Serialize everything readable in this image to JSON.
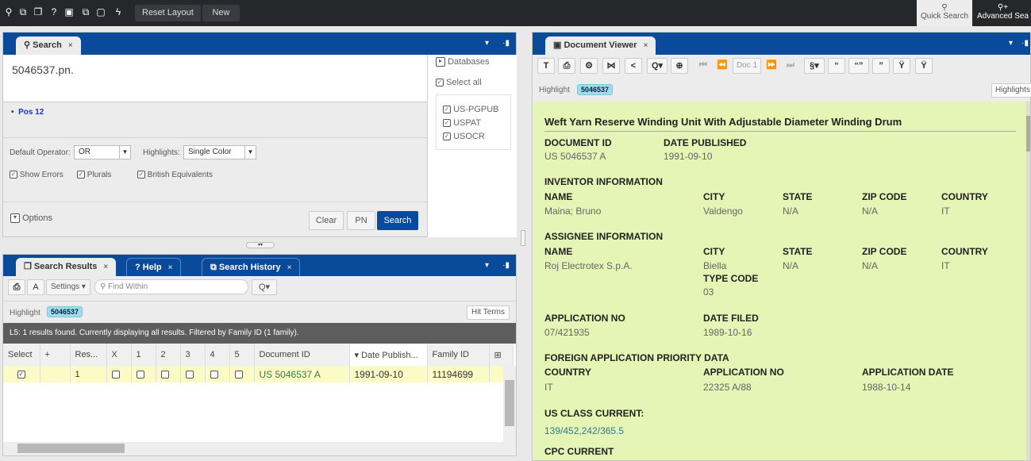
{
  "topbar": {
    "icons": [
      "search-icon",
      "search-copy-icon",
      "documents-icon",
      "help-icon",
      "save-icon",
      "export-icon",
      "blank-page-icon",
      "lightning-icon"
    ],
    "reset_layout": "Reset Layout",
    "new": "New",
    "quick_search": "Quick Search",
    "advanced_search": "Advanced Sea"
  },
  "search_panel": {
    "tab": "Search",
    "query": "5046537.pn.",
    "pos": "Pos 12",
    "default_operator_label": "Default Operator:",
    "default_operator": "OR",
    "highlights_label": "Highlights:",
    "highlights": "Single Color",
    "show_errors": "Show Errors",
    "plurals": "Plurals",
    "british": "British Equivalents",
    "options": "Options",
    "clear": "Clear",
    "pn": "PN",
    "search": "Search",
    "databases": "Databases",
    "select_all": "Select all",
    "dbs": [
      "US-PGPUB",
      "USPAT",
      "USOCR"
    ]
  },
  "results_panel": {
    "tabs": [
      "Search Results",
      "Help",
      "Search History"
    ],
    "settings": "Settings",
    "find_placeholder": "Find Within",
    "highlight_label": "Highlight",
    "highlight_term": "5046537",
    "hit_terms": "Hit Terms",
    "status": "L5: 1 results found. Currently displaying all results. Filtered by Family ID (1 family).",
    "columns": [
      "Select",
      "+",
      "Res...",
      "X",
      "1",
      "2",
      "3",
      "4",
      "5",
      "Document ID",
      "▾ Date Publish...",
      "Family ID"
    ],
    "row": {
      "result": "1",
      "document_id": "US 5046537 A",
      "date": "1991-09-10",
      "family_id": "11194699"
    }
  },
  "viewer": {
    "tab": "Document Viewer",
    "doc_nav": "Doc 1",
    "highlight_label": "Highlight",
    "highlight_term": "5046537",
    "highlights_btn": "Highlights",
    "title": "Weft Yarn Reserve Winding Unit With Adjustable Diameter Winding Drum",
    "document_id_label": "DOCUMENT ID",
    "document_id": "US 5046537 A",
    "date_published_label": "DATE PUBLISHED",
    "date_published": "1991-09-10",
    "inventor_section": "INVENTOR INFORMATION",
    "assignee_section": "ASSIGNEE INFORMATION",
    "name_label": "NAME",
    "city_label": "CITY",
    "state_label": "STATE",
    "zip_label": "ZIP CODE",
    "country_label": "COUNTRY",
    "inventor": {
      "name": "Maina; Bruno",
      "city": "Valdengo",
      "state": "N/A",
      "zip": "N/A",
      "country": "IT"
    },
    "assignee": {
      "name": "Roj Electrotex S.p.A.",
      "city": "Biella",
      "state": "N/A",
      "zip": "N/A",
      "country": "IT",
      "type_code_label": "TYPE CODE",
      "type_code": "03"
    },
    "application_no_label": "APPLICATION NO",
    "application_no": "07/421935",
    "date_filed_label": "DATE FILED",
    "date_filed": "1989-10-16",
    "foreign_section": "FOREIGN APPLICATION PRIORITY DATA",
    "foreign": {
      "country": "IT",
      "application_no": "22325 A/88",
      "application_date_label": "APPLICATION DATE",
      "application_date": "1988-10-14"
    },
    "us_class_label": "US CLASS CURRENT:",
    "us_class": "139/452,242/365.5",
    "cpc_label": "CPC CURRENT"
  }
}
